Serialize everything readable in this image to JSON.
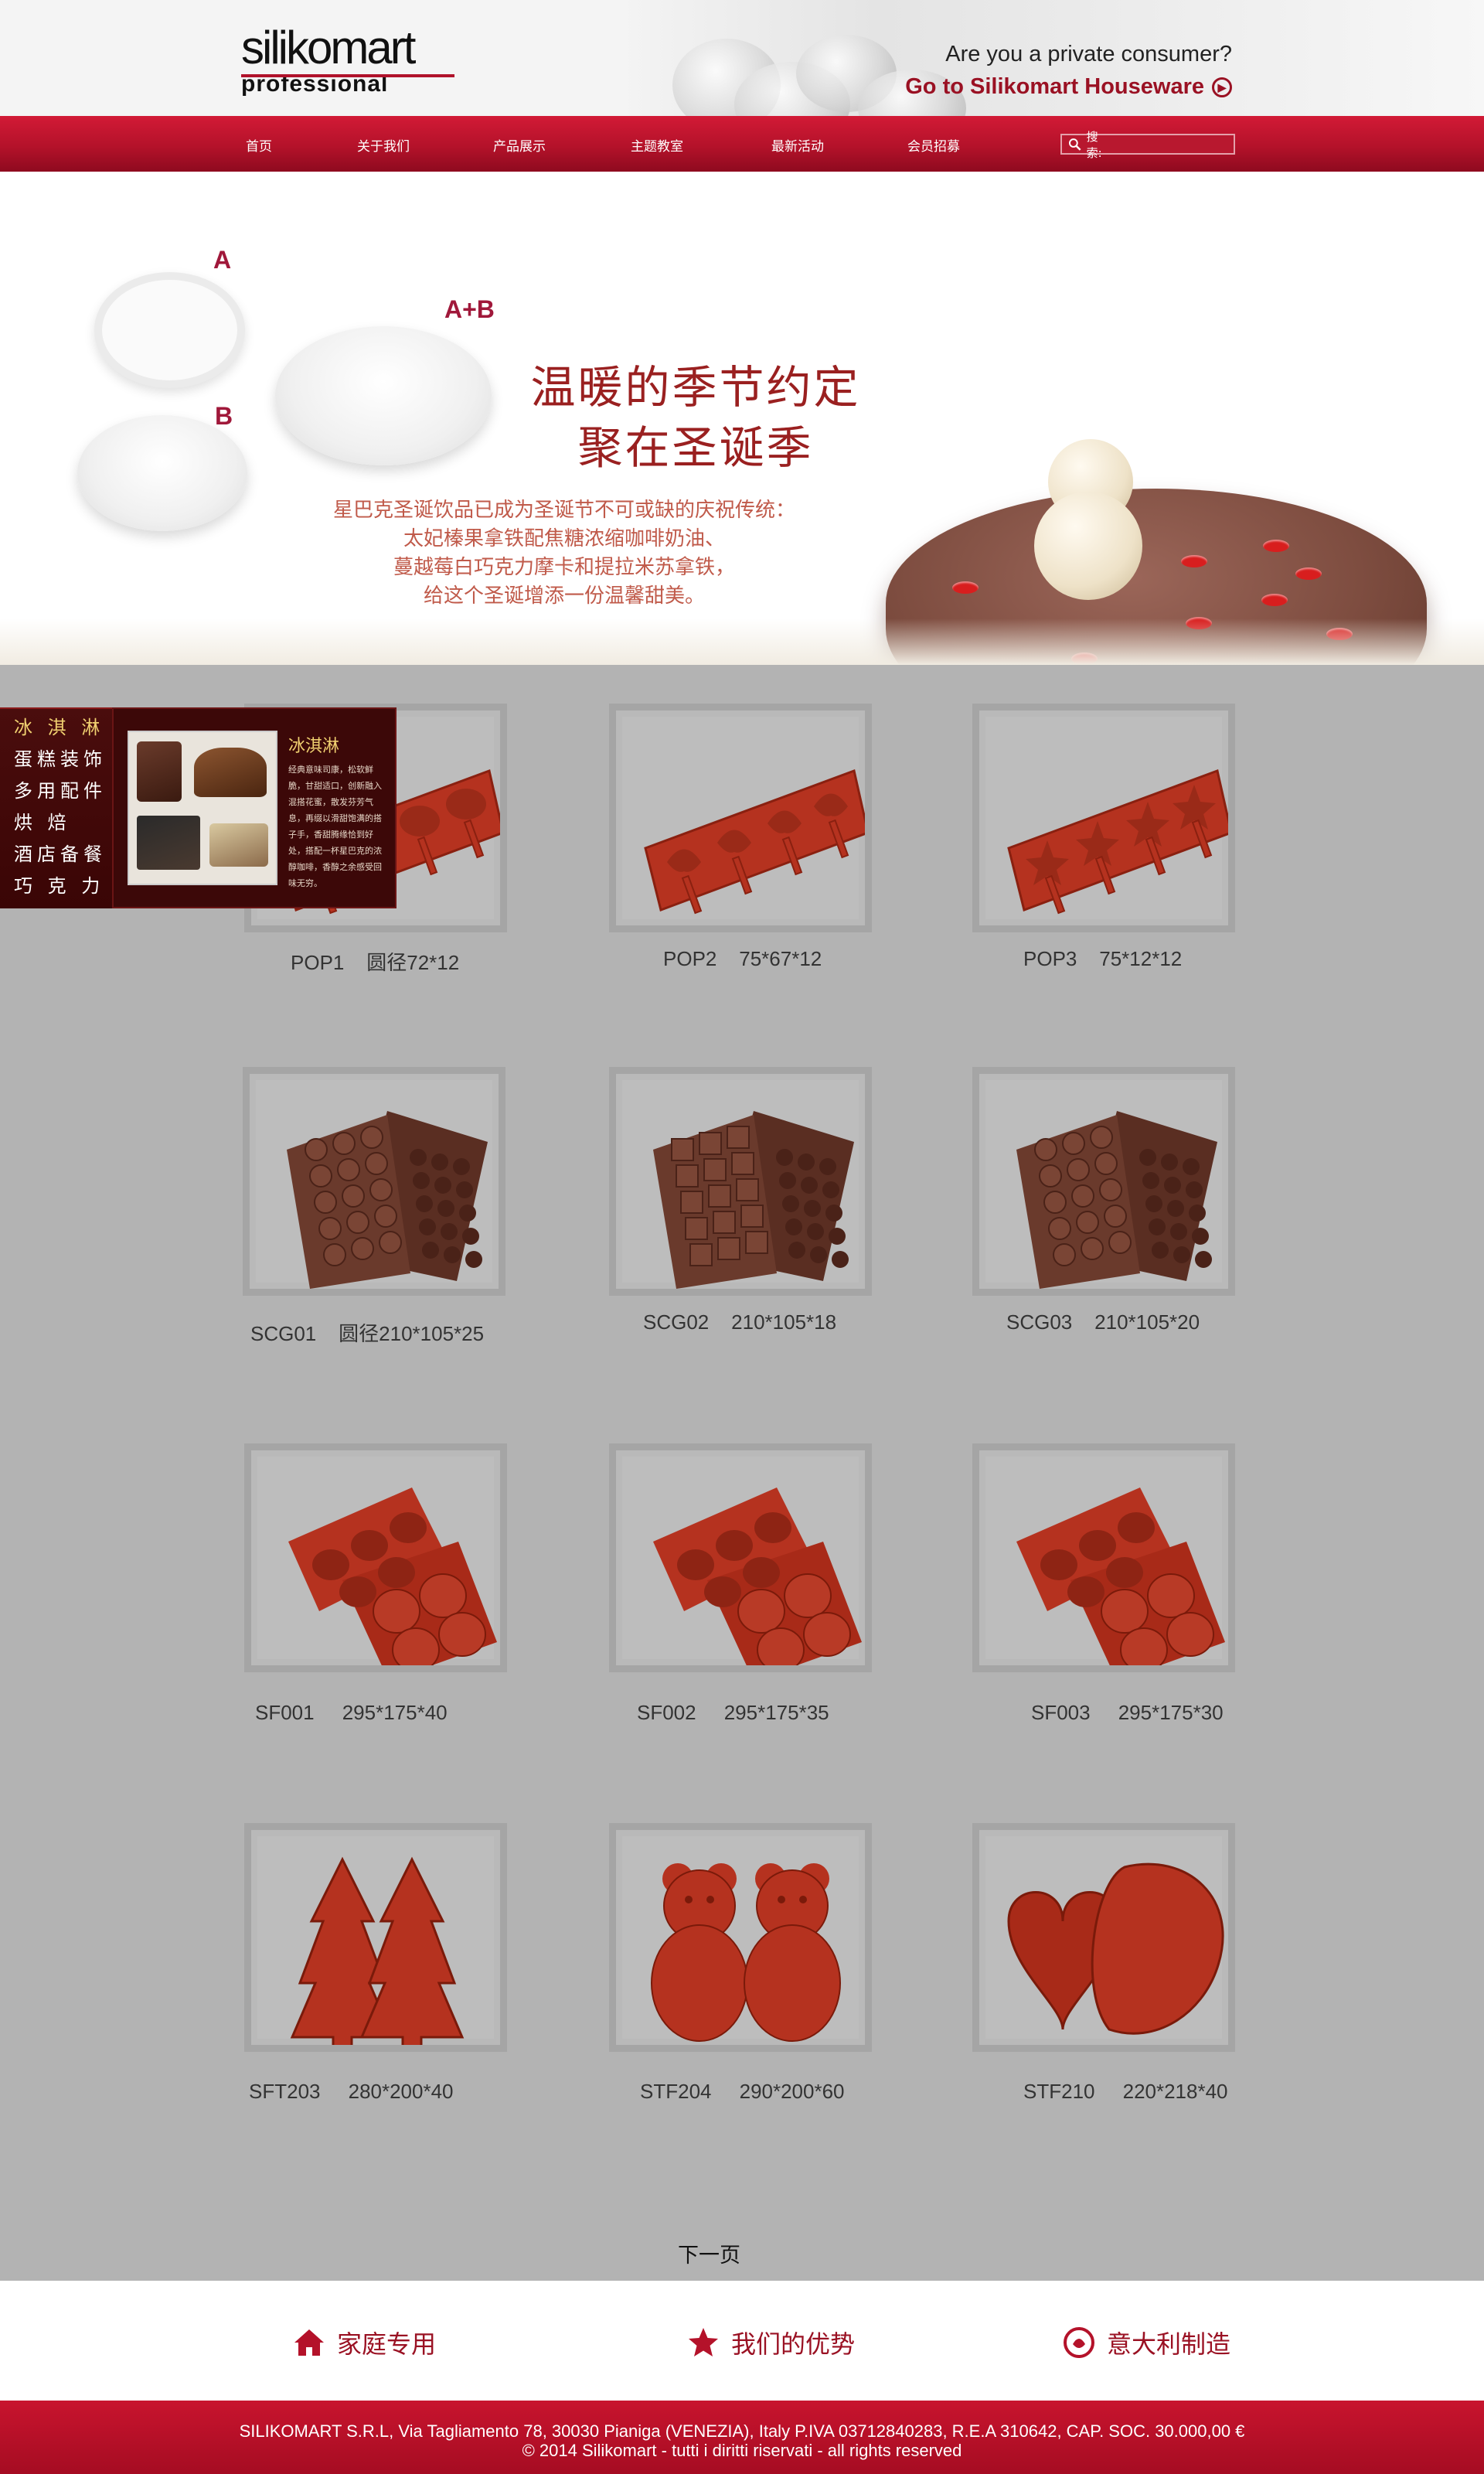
{
  "header": {
    "brand_name": "silikomart",
    "brand_sub": "professional",
    "consumer_question": "Are you a private consumer?",
    "consumer_link": "Go to Silikomart Houseware"
  },
  "nav": {
    "items": [
      "首页",
      "关于我们",
      "产品展示",
      "主题教室",
      "最新活动",
      "会员招募"
    ],
    "search_label": "搜索:",
    "search_value": ""
  },
  "banner": {
    "label_a": "A",
    "label_b": "B",
    "label_ab": "A+B",
    "title_line1": "温暖的季节约定",
    "title_line2": "聚在圣诞季",
    "desc_lines": [
      "星巴克圣诞饮品已成为圣诞节不可或缺的庆祝传统：",
      "太妃榛果拿铁配焦糖浓缩咖啡奶油、",
      "蔓越莓白巧克力摩卡和提拉米苏拿铁，",
      "给这个圣诞增添一份温馨甜美。"
    ]
  },
  "side_menu": {
    "items": [
      "冰 淇 淋",
      "蛋糕装饰",
      "多用配件",
      "烘      焙",
      "酒店备餐",
      "巧  克  力"
    ],
    "active_index": 0,
    "popup_title": "冰淇淋",
    "popup_text": "经典意味司康，松软鲜脆，甘甜适口，创新融入混搭花蜜，散发芬芳气息，再缀以滑甜饱满的搭子手，香甜腾缘恰到好处，搭配一杯星巴克的浓醇咖啡，香醇之余感受回味无穷。"
  },
  "products": [
    {
      "caption": "POP1    圆径72*12",
      "shape": "pop-round"
    },
    {
      "caption": "POP2    75*67*12",
      "shape": "pop-flower"
    },
    {
      "caption": "POP3    75*12*12",
      "shape": "pop-star"
    },
    {
      "caption": "SCG01    圆径210*105*25",
      "shape": "choc-dome"
    },
    {
      "caption": "SCG02    210*105*18",
      "shape": "choc-square"
    },
    {
      "caption": "SCG03    210*105*20",
      "shape": "choc-round"
    },
    {
      "caption": "SF001     295*175*40",
      "shape": "sf-half"
    },
    {
      "caption": "SF002     295*175*35",
      "shape": "sf-half"
    },
    {
      "caption": "SF003     295*175*30",
      "shape": "sf-half"
    },
    {
      "caption": "SFT203     280*200*40",
      "shape": "tree"
    },
    {
      "caption": "STF204     290*200*60",
      "shape": "bear"
    },
    {
      "caption": "STF210     220*218*40",
      "shape": "heart"
    }
  ],
  "next_page": "下一页",
  "footer_links": [
    {
      "label": "家庭专用",
      "icon": "house-icon"
    },
    {
      "label": "我们的优势",
      "icon": "star-icon"
    },
    {
      "label": "意大利制造",
      "icon": "italy-badge-icon"
    }
  ],
  "footer": {
    "line1": "SILIKOMART S.R.L, Via Tagliamento 78, 30030 Pianiga (VENEZIA), Italy P.IVA 03712840283, R.E.A 310642, CAP. SOC. 30.000,00 €",
    "line2": "© 2014 Silikomart - tutti i diritti riservati - all rights reserved"
  },
  "colors": {
    "brand_red": "#b4122a",
    "product_red": "#b5321f",
    "chocolate": "#6a3a2c",
    "grey_area": "#b3b3b3"
  }
}
